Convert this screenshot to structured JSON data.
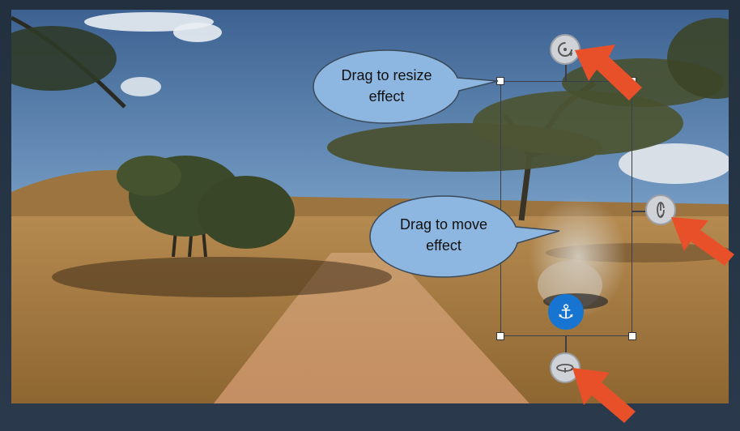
{
  "callouts": {
    "resize": {
      "line1": "Drag to resize",
      "line2": "effect"
    },
    "move": {
      "line1": "Drag to move",
      "line2": "effect"
    }
  },
  "icons": {
    "rotate_top": "rotate-icon",
    "rotate_side": "rotate-vertical-icon",
    "rotate_bottom": "rotate-horizontal-icon",
    "anchor": "anchor-icon",
    "anchor_glyph": "⚓",
    "pointer": "arrow-icon"
  },
  "colors": {
    "callout_fill": "#8db6e0",
    "callout_stroke": "#3a4a5a",
    "anchor": "#1774d1",
    "arrow": "#e8502a"
  }
}
